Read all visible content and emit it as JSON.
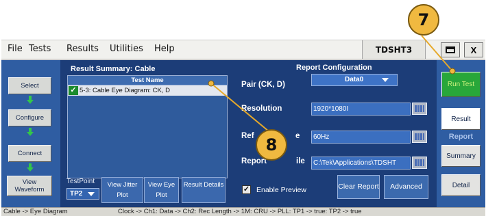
{
  "callouts": {
    "seven": "7",
    "eight": "8"
  },
  "menu": [
    "File",
    "Tests",
    "Results",
    "Utilities",
    "Help"
  ],
  "app_title": "TDSHT3",
  "window": {
    "close": "X"
  },
  "left_nav": [
    "Select",
    "Configure",
    "Connect",
    "View Waveform"
  ],
  "result_summary": {
    "title": "Result Summary: Cable",
    "column": "Test Name",
    "rows": [
      {
        "checked": true,
        "name": "5-3: Cable Eye Diagram: CK, D"
      }
    ]
  },
  "testpoint": {
    "label": "TestPoint",
    "value": "TP2"
  },
  "bottom_buttons": [
    "View Jitter Plot",
    "View Eye Plot",
    "Result Details"
  ],
  "report_config": {
    "title": "Report Configuration",
    "pair_label": "Pair (CK, D)",
    "pair_value": "Data0",
    "resolution_label": "Resolution",
    "resolution_value": "1920*1080I",
    "refresh_label": "Ref",
    "refresh_label_tail": "e",
    "refresh_value": "60Hz",
    "report_label": "Report",
    "report_label_tail": "ile",
    "report_value": "C:\\Tek\\Applications\\TDSHT",
    "enable_preview": "Enable Preview",
    "clear_report": "Clear Report",
    "advanced": "Advanced"
  },
  "right_panel": {
    "run_test": "Run Test",
    "result": "Result",
    "report_header": "Report",
    "summary": "Summary",
    "detail": "Detail"
  },
  "status_bar": {
    "left": "Cable -> Eye Diagram",
    "right": "Clock -> Ch1: Data -> Ch2: Rec Length -> 1M: CRU -> PLL: TP1 -> true: TP2 -> true"
  }
}
